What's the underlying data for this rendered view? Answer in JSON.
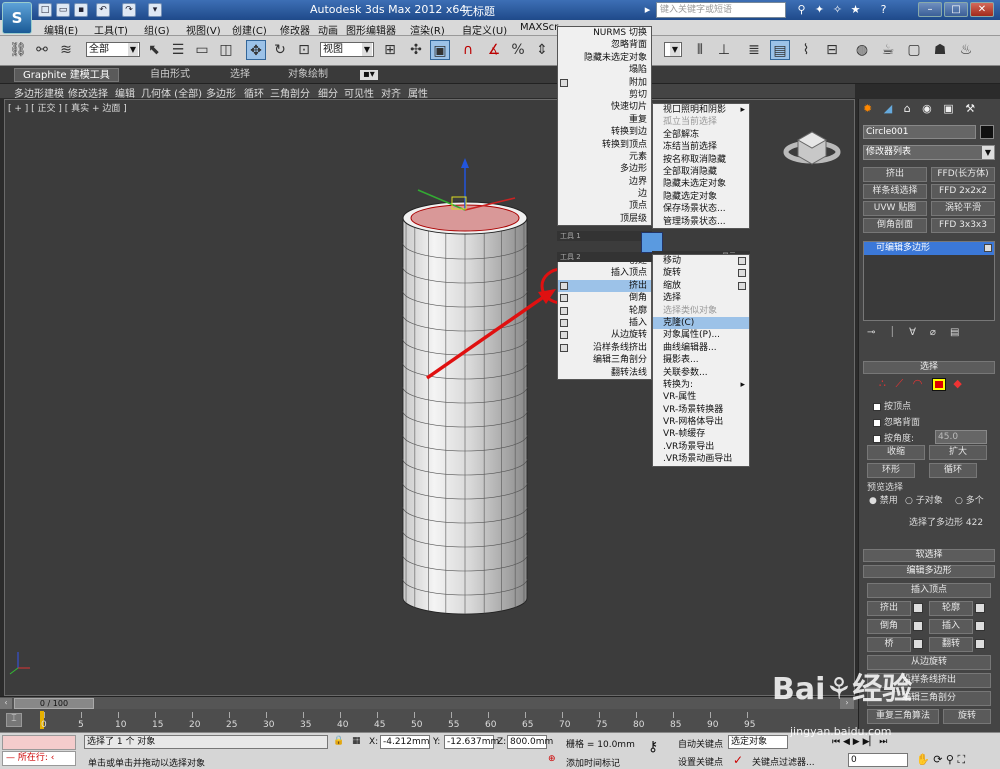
{
  "titlebar": {
    "app_title": "Autodesk 3ds Max  2012 x64",
    "file_name": "无标题",
    "search_placeholder": "键入关键字或短语"
  },
  "menubar": [
    "编辑(E)",
    "工具(T)",
    "组(G)",
    "视图(V)",
    "创建(C)",
    "修改器",
    "动画",
    "图形编辑器",
    "渲染(R)",
    "自定义(U)",
    "MAXScr"
  ],
  "toolbar": {
    "selection_filter": "全部",
    "reference_coord": "视图"
  },
  "ribbon": {
    "tabs": [
      "Graphite 建模工具",
      "自由形式",
      "选择",
      "对象绘制"
    ],
    "sub_items": [
      "多边形建模",
      "修改选择",
      "编辑",
      "几何体 (全部)",
      "多边形",
      "循环",
      "三角剖分",
      "细分",
      "可见性",
      "对齐",
      "属性"
    ]
  },
  "viewport": {
    "label": "[ + ] [ 正交 ] [ 真实 + 边面 ]"
  },
  "quad_left": {
    "top_items": [
      "NURMS 切换",
      "忽略背面",
      "隐藏未选定对象",
      "塌陷",
      "附加",
      "剪切",
      "快速切片",
      "重复",
      "转换到边",
      "转换到顶点",
      "元素",
      "多边形",
      "边界",
      "边",
      "顶点",
      "顶层级"
    ],
    "bar1": "工具 1",
    "bar2": "工具 2",
    "bottom_items": [
      "创建",
      "插入顶点",
      "挤出",
      "倒角",
      "轮廓",
      "插入",
      "从边旋转",
      "沿样条线挤出",
      "编辑三角剖分",
      "翻转法线"
    ]
  },
  "quad_right": {
    "top_items": [
      "视口照明和阴影",
      "孤立当前选择",
      "全部解冻",
      "冻结当前选择",
      "按名称取消隐藏",
      "全部取消隐藏",
      "隐藏未选定对象",
      "隐藏选定对象",
      "保存场景状态...",
      "管理场景状态..."
    ],
    "bar1": "显示",
    "bar2": "变换",
    "bottom_items": [
      "移动",
      "旋转",
      "缩放",
      "选择",
      "选择类似对象",
      "克隆(C)",
      "对象属性(P)...",
      "曲线编辑器...",
      "摄影表...",
      "关联参数...",
      "转换为:",
      "VR-属性",
      "VR-场景转换器",
      "VR-网格体导出",
      "VR-帧缓存",
      ".VR场景导出",
      ".VR场景动画导出"
    ]
  },
  "right_panel": {
    "object_name": "Circle001",
    "modifier_list": "修改器列表",
    "buttons": [
      "挤出",
      "FFD(长方体)",
      "样条线选择",
      "FFD 2x2x2",
      "UVW 贴图",
      "涡轮平滑",
      "倒角剖面",
      "FFD 3x3x3"
    ],
    "stack_item": "可编辑多边形",
    "selection_header": "选择",
    "by_vertex": "按顶点",
    "ignore_backface": "忽略背面",
    "by_angle": "按角度:",
    "angle_value": "45.0",
    "shrink": "收缩",
    "grow": "扩大",
    "ring": "环形",
    "loop": "循环",
    "preview_title": "预览选择",
    "preview_opts": [
      "禁用",
      "子对象",
      "多个"
    ],
    "selected_count": "选择了多边形 422",
    "soft_sel": "软选择",
    "edit_poly": "编辑多边形",
    "insert_vertex": "插入顶点",
    "ops": [
      "挤出",
      "轮廓",
      "倒角",
      "插入",
      "桥",
      "翻转"
    ],
    "hinge": "从边旋转",
    "extrude_spline": "沿样条线挤出",
    "edit_tri": "编辑三角剖分",
    "retri": "重复三角算法",
    "turn": "旋转"
  },
  "timeline": {
    "frame": "0 / 100",
    "ticks": [
      "0",
      "5",
      "10",
      "15",
      "20",
      "25",
      "30",
      "35",
      "40",
      "45",
      "50",
      "55",
      "60",
      "65",
      "70",
      "75",
      "80",
      "85",
      "90",
      "95"
    ]
  },
  "status": {
    "max_listener": "所在行:",
    "selected_text": "选择了 1 个 对象",
    "prompt": "单击或单击并拖动以选择对象",
    "x_value": "-4.212mm",
    "y_value": "-12.637mm",
    "z_value": "800.0mm",
    "grid": "栅格 = 10.0mm",
    "auto_key": "自动关键点",
    "set_key": "设置关键点",
    "selected_dd": "选定对象",
    "key_filters": "关键点过滤器...",
    "add_tag": "添加时间标记",
    "frame_field": "0"
  },
  "watermark": "jingyan.baidu.com"
}
